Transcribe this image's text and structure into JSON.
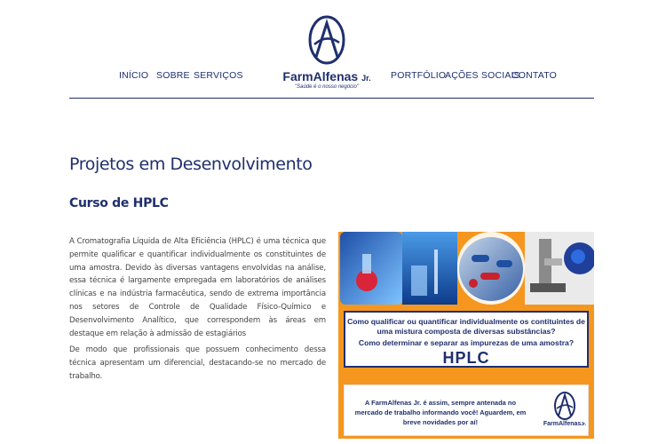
{
  "nav": {
    "left": [
      "INÍCIO",
      "SOBRE",
      "SERVIÇOS"
    ],
    "right": [
      "PORTFÓLIO",
      "AÇÕES SOCIAIS",
      "CONTATO"
    ]
  },
  "logo": {
    "name": "FarmAlfenas",
    "suffix": "Jr.",
    "tagline": "\"Saúde é o nosso negócio\""
  },
  "main": {
    "title": "Projetos em Desenvolvimento",
    "subtitle": "Curso de HPLC",
    "paragraphs": [
      "A Cromatografia Líquida de Alta Eficiência (HPLC) é uma técnica que permite qualificar e quantificar individualmente os constituintes de uma amostra. Devido às diversas vantagens envolvidas na análise, essa técnica é largamente empregada em laboratórios de análises clínicas e na indústria farmacêutica, sendo de extrema importância nos setores de Controle de Qualidade Físico-Químico e Desenvolvimento Analítico, que correspondem às áreas em destaque em relação à admissão de estagiários",
      "De modo que profissionais que possuem conhecimento dessa técnica apresentam um diferencial, destacando-se no mercado de trabalho."
    ]
  },
  "banner": {
    "question1": "Como qualificar ou quantificar individualmente os contituintes de uma mistura composta de diversas substâncias?",
    "question2": "Como determinar e separar as impurezas de uma amostra?",
    "heading": "HPLC",
    "promo": "A FarmAlfenas Jr. é assim, sempre antenada no mercado de trabalho informando você! Aguardem, em breve novidades por aí!",
    "logo_name": "FarmAlfenas",
    "logo_suffix": "Jr."
  },
  "colors": {
    "brand_navy": "#1f2f6e",
    "banner_orange": "#f5971f"
  }
}
